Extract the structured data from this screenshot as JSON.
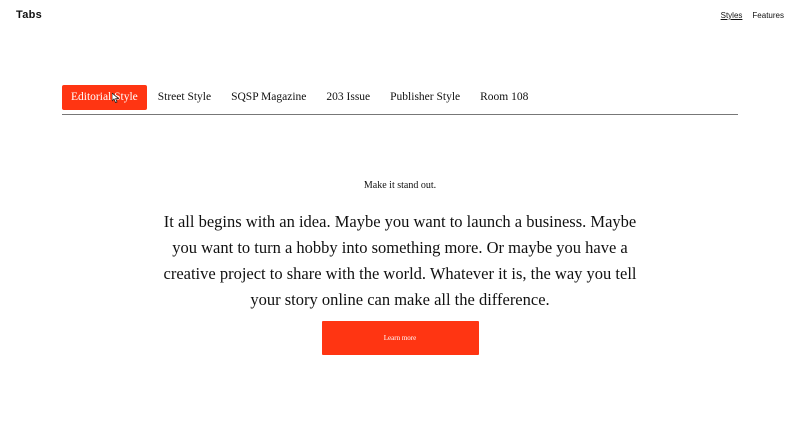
{
  "header": {
    "site_title": "Tabs",
    "nav": [
      {
        "label": "Styles",
        "active": true
      },
      {
        "label": "Features",
        "active": false
      }
    ]
  },
  "tabs": [
    {
      "label": "Editorial Style",
      "active": true
    },
    {
      "label": "Street Style",
      "active": false
    },
    {
      "label": "SQSP Magazine",
      "active": false
    },
    {
      "label": "203 Issue",
      "active": false
    },
    {
      "label": "Publisher Style",
      "active": false
    },
    {
      "label": "Room 108",
      "active": false
    }
  ],
  "panel": {
    "kicker": "Make it stand out.",
    "body": "It all begins with an idea. Maybe you want to launch a business. Maybe you want to turn a hobby into something more. Or maybe you have a creative project to share with the world. Whatever it is, the way you tell your story online can make all the difference.",
    "button_label": "Learn more"
  },
  "colors": {
    "accent": "#ff3512",
    "text": "#111111",
    "rule": "#777777",
    "background": "#ffffff"
  }
}
